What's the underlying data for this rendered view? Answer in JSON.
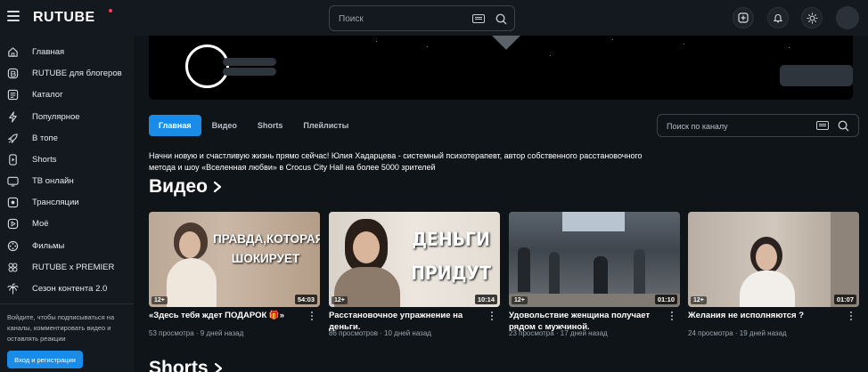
{
  "header": {
    "logo": "RUTUBE",
    "search_placeholder": "Поиск"
  },
  "sidebar": {
    "items": [
      {
        "label": "Главная",
        "icon": "home-icon"
      },
      {
        "label": "RUTUBE для блогеров",
        "icon": "blogger-icon"
      },
      {
        "label": "Каталог",
        "icon": "catalog-icon"
      },
      {
        "label": "Популярное",
        "icon": "lightning-icon"
      },
      {
        "label": "В топе",
        "icon": "rocket-icon"
      },
      {
        "label": "Shorts",
        "icon": "shorts-icon"
      },
      {
        "label": "ТВ онлайн",
        "icon": "tv-icon"
      },
      {
        "label": "Трансляции",
        "icon": "broadcast-icon"
      },
      {
        "label": "Моё",
        "icon": "play-circle-icon"
      },
      {
        "label": "Фильмы",
        "icon": "films-icon"
      },
      {
        "label": "RUTUBE x PREMIER",
        "icon": "premier-icon"
      },
      {
        "label": "Сезон контента 2.0",
        "icon": "palm-icon"
      }
    ],
    "signin_text": "Войдите, чтобы подписываться на каналы, комментировать видео и оставлять реакции",
    "signin_button": "Вход и регистрация"
  },
  "channel": {
    "tabs": [
      "Главная",
      "Видео",
      "Shorts",
      "Плейлисты"
    ],
    "active_tab": "Главная",
    "search_placeholder": "Поиск по каналу",
    "description": "Начни новую и счастливую жизнь прямо сейчас! Юлия Хадарцева - системный психотерапевт, автор собственного расстановочного метода и шоу «Вселенная любви» в Crocus City Hall на более 5000 зрителей"
  },
  "videos_section": {
    "title": "Видео",
    "cards": [
      {
        "title": "«Здесь тебя ждет ПОДАРОК 🎁»",
        "views": "53 просмотра",
        "date": "9 дней назад",
        "duration": "54:03",
        "age": "12+",
        "overlay": "ПРАВДА,КОТОРАЯ ШОКИРУЕТ"
      },
      {
        "title": "Расстановочное упражнение на деньги.",
        "views": "86 просмотров",
        "date": "10 дней назад",
        "duration": "10:14",
        "age": "12+",
        "overlay": "ДЕНЬГИ ПРИДУТ"
      },
      {
        "title": "Удовольствие женщина получает рядом с мужчиной.",
        "views": "23 просмотра",
        "date": "17 дней назад",
        "duration": "01:10",
        "age": "12+",
        "overlay": ""
      },
      {
        "title": "Желания не исполняются ?",
        "views": "24 просмотра",
        "date": "19 дней назад",
        "duration": "01:07",
        "age": "12+",
        "overlay": ""
      }
    ]
  },
  "shorts_section": {
    "title": "Shorts"
  },
  "colors": {
    "accent": "#1a8ce8",
    "background": "#14191f",
    "main_background": "#0f1419"
  }
}
